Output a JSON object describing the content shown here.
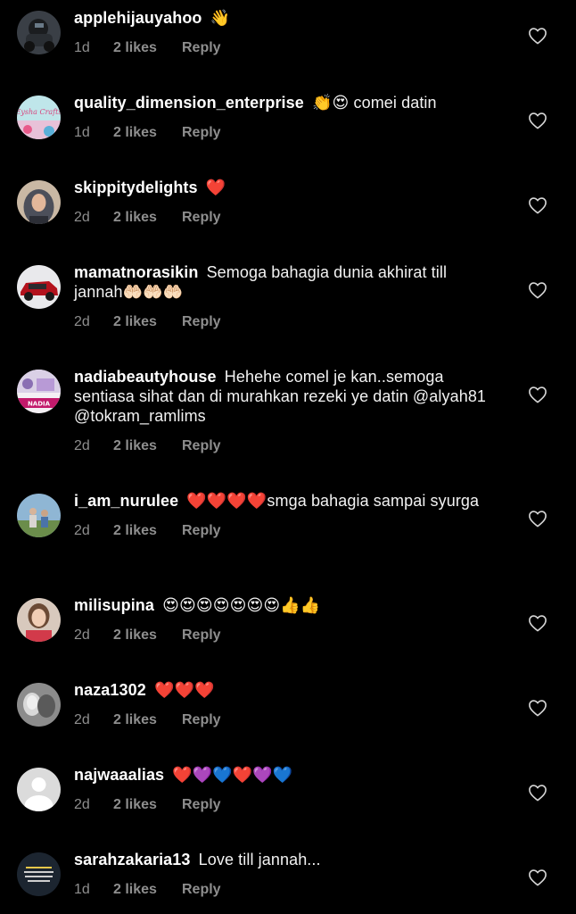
{
  "comments": [
    {
      "username": "applehijauyahoo",
      "text": "👋",
      "time": "1d",
      "likes": "2 likes",
      "reply": "Reply",
      "avatar_icon": "motorbike-avatar-icon"
    },
    {
      "username": "quality_dimension_enterprise",
      "text": "👏😍 comei datin",
      "time": "1d",
      "likes": "2 likes",
      "reply": "Reply",
      "avatar_icon": "crafts-logo-avatar-icon",
      "avatar_text": "Eysha Crafts"
    },
    {
      "username": "skippitydelights",
      "text": "❤️",
      "time": "2d",
      "likes": "2 likes",
      "reply": "Reply",
      "avatar_icon": "hijab-woman-avatar-icon"
    },
    {
      "username": "mamatnorasikin",
      "text": "Semoga bahagia dunia akhirat till jannah🤲🏻🤲🏻🤲🏻",
      "time": "2d",
      "likes": "2 likes",
      "reply": "Reply",
      "avatar_icon": "red-car-avatar-icon"
    },
    {
      "username": "nadiabeautyhouse",
      "text": "Hehehe comel je kan..semoga sentiasa sihat dan di murahkan rezeki ye datin @alyah81 @tokram_ramlims",
      "time": "2d",
      "likes": "2 likes",
      "reply": "Reply",
      "avatar_icon": "beauty-shop-avatar-icon",
      "avatar_text": "NADIA"
    },
    {
      "username": "i_am_nurulee",
      "text": "❤️❤️❤️❤️smga bahagia sampai syurga",
      "time": "2d",
      "likes": "2 likes",
      "reply": "Reply",
      "avatar_icon": "outdoor-people-avatar-icon"
    },
    {
      "username": "milisupina",
      "text": "😍😍😍😍😍😍😍👍👍",
      "time": "2d",
      "likes": "2 likes",
      "reply": "Reply",
      "avatar_icon": "woman-portrait-avatar-icon"
    },
    {
      "username": "naza1302",
      "text": "❤️❤️❤️",
      "time": "2d",
      "likes": "2 likes",
      "reply": "Reply",
      "avatar_icon": "couple-photo-avatar-icon"
    },
    {
      "username": "najwaaalias",
      "text": "❤️💜💙❤️💜💙",
      "time": "2d",
      "likes": "2 likes",
      "reply": "Reply",
      "avatar_icon": "default-user-avatar-icon"
    },
    {
      "username": "sarahzakaria13",
      "text": "Love till jannah...",
      "time": "1d",
      "likes": "2 likes",
      "reply": "Reply",
      "avatar_icon": "quote-image-avatar-icon"
    }
  ],
  "colors": {
    "background": "#000000",
    "text": "#f2f2f2",
    "meta": "#8e8e8e"
  }
}
